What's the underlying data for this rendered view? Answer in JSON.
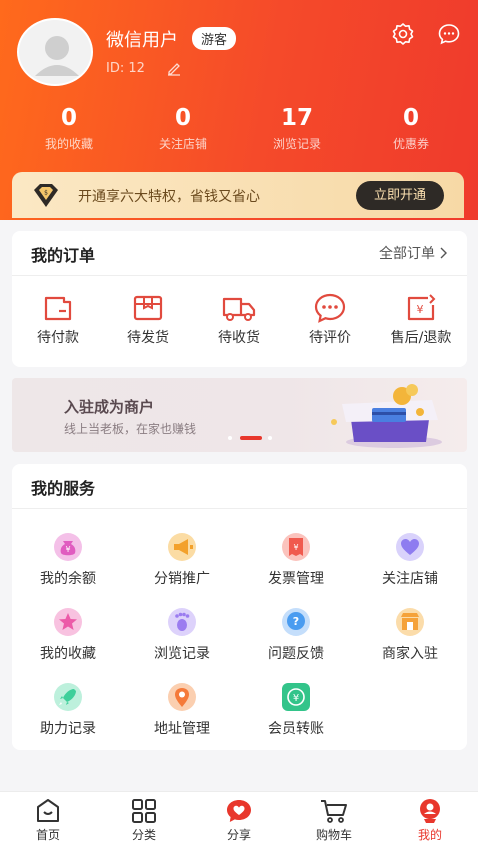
{
  "profile": {
    "name": "微信用户",
    "badge": "游客",
    "id_text": "ID:  12"
  },
  "stats": [
    {
      "value": "0",
      "label": "我的收藏"
    },
    {
      "value": "0",
      "label": "关注店铺"
    },
    {
      "value": "17",
      "label": "浏览记录"
    },
    {
      "value": "0",
      "label": "优惠券"
    }
  ],
  "vip": {
    "text": "开通享六大特权，省钱又省心",
    "button": "立即开通"
  },
  "orders": {
    "title": "我的订单",
    "all_label": "全部订单",
    "items": [
      {
        "label": "待付款",
        "icon": "wallet-icon"
      },
      {
        "label": "待发货",
        "icon": "package-icon"
      },
      {
        "label": "待收货",
        "icon": "truck-icon"
      },
      {
        "label": "待评价",
        "icon": "comment-icon"
      },
      {
        "label": "售后/退款",
        "icon": "refund-icon"
      }
    ]
  },
  "merchant_banner": {
    "title": "入驻成为商户",
    "subtitle": "线上当老板，在家也赚钱"
  },
  "services": {
    "title": "我的服务",
    "items": [
      {
        "label": "我的余额",
        "icon": "money-bag-icon",
        "color": "#e05cc0"
      },
      {
        "label": "分销推广",
        "icon": "megaphone-icon",
        "color": "#f3a12c"
      },
      {
        "label": "发票管理",
        "icon": "invoice-icon",
        "color": "#f05a4e"
      },
      {
        "label": "关注店铺",
        "icon": "heart-icon",
        "color": "#8e7cf0"
      },
      {
        "label": "我的收藏",
        "icon": "star-icon",
        "color": "#ec5aa8"
      },
      {
        "label": "浏览记录",
        "icon": "footprint-icon",
        "color": "#9b7cf0"
      },
      {
        "label": "问题反馈",
        "icon": "question-icon",
        "color": "#4a9cf0"
      },
      {
        "label": "商家入驻",
        "icon": "shop-icon",
        "color": "#f5a23a"
      },
      {
        "label": "助力记录",
        "icon": "rocket-icon",
        "color": "#3ecf9a"
      },
      {
        "label": "地址管理",
        "icon": "location-icon",
        "color": "#f57a3a"
      },
      {
        "label": "会员转账",
        "icon": "transfer-icon",
        "color": "#33c48a"
      }
    ]
  },
  "tabs": [
    {
      "label": "首页",
      "icon": "home-icon"
    },
    {
      "label": "分类",
      "icon": "category-icon"
    },
    {
      "label": "分享",
      "icon": "share-icon"
    },
    {
      "label": "购物车",
      "icon": "cart-icon"
    },
    {
      "label": "我的",
      "icon": "profile-icon",
      "active": true
    }
  ],
  "colors": {
    "header_start": "#ff6a1c",
    "header_end": "#ef3a2c",
    "accent": "#e8372c",
    "vip_gold": "#fbe8c4"
  }
}
